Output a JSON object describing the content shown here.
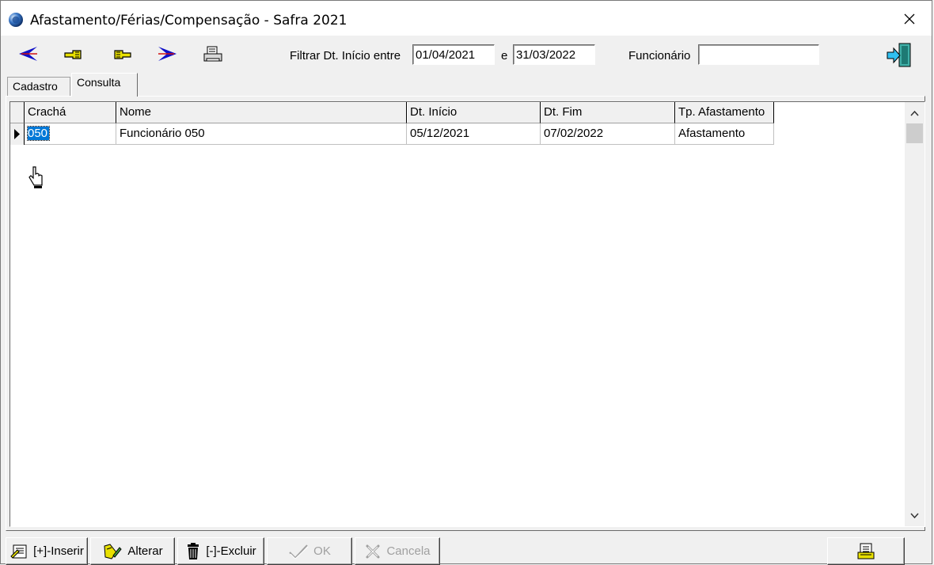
{
  "window": {
    "title": "Afastamento/Férias/Compensação - Safra 2021"
  },
  "toolbar": {
    "icons": [
      "first-record-icon",
      "previous-record-icon",
      "next-record-icon",
      "last-record-icon",
      "print-icon",
      "exit-icon"
    ]
  },
  "filter": {
    "label": "Filtrar Dt. Início entre",
    "date_start": "01/04/2021",
    "connector": "e",
    "date_end": "31/03/2022",
    "employee_label": "Funcionário",
    "employee_value": ""
  },
  "tabs": [
    {
      "label": "Cadastro",
      "active": false
    },
    {
      "label": "Consulta",
      "active": true
    }
  ],
  "grid": {
    "columns": [
      "Crachá",
      "Nome",
      "Dt. Início",
      "Dt. Fim",
      "Tp. Afastamento"
    ],
    "rows": [
      [
        "050",
        "Funcionário 050",
        "05/12/2021",
        "07/02/2022",
        "Afastamento"
      ]
    ]
  },
  "buttons": {
    "insert": "[+]-Inserir",
    "edit": "Alterar",
    "delete": "[-]-Excluir",
    "ok": "OK",
    "cancel": "Cancela"
  }
}
